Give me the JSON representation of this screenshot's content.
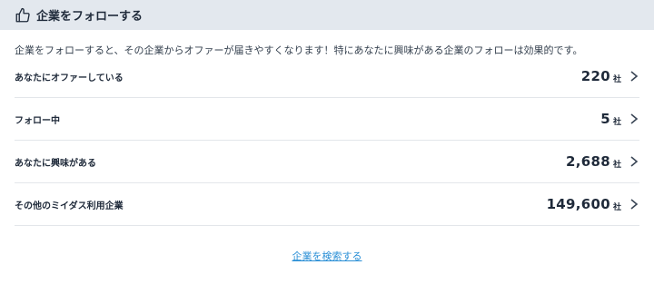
{
  "header": {
    "title": "企業をフォローする",
    "icon": "thumbs-up-icon"
  },
  "description": "企業をフォローすると、その企業からオファーが届きやすくなります！特にあなたに興味がある企業のフォローは効果的です。",
  "rows": [
    {
      "label": "あなたにオファーしている",
      "count": "220",
      "unit": "社"
    },
    {
      "label": "フォロー中",
      "count": "5",
      "unit": "社"
    },
    {
      "label": "あなたに興味がある",
      "count": "2,688",
      "unit": "社"
    },
    {
      "label": "その他のミイダス利用企業",
      "count": "149,600",
      "unit": "社"
    }
  ],
  "footer": {
    "search_link": "企業を検索する"
  },
  "colors": {
    "header_bg": "#e3e8ee",
    "link": "#2a8fd6",
    "text": "#1f2a3a"
  }
}
